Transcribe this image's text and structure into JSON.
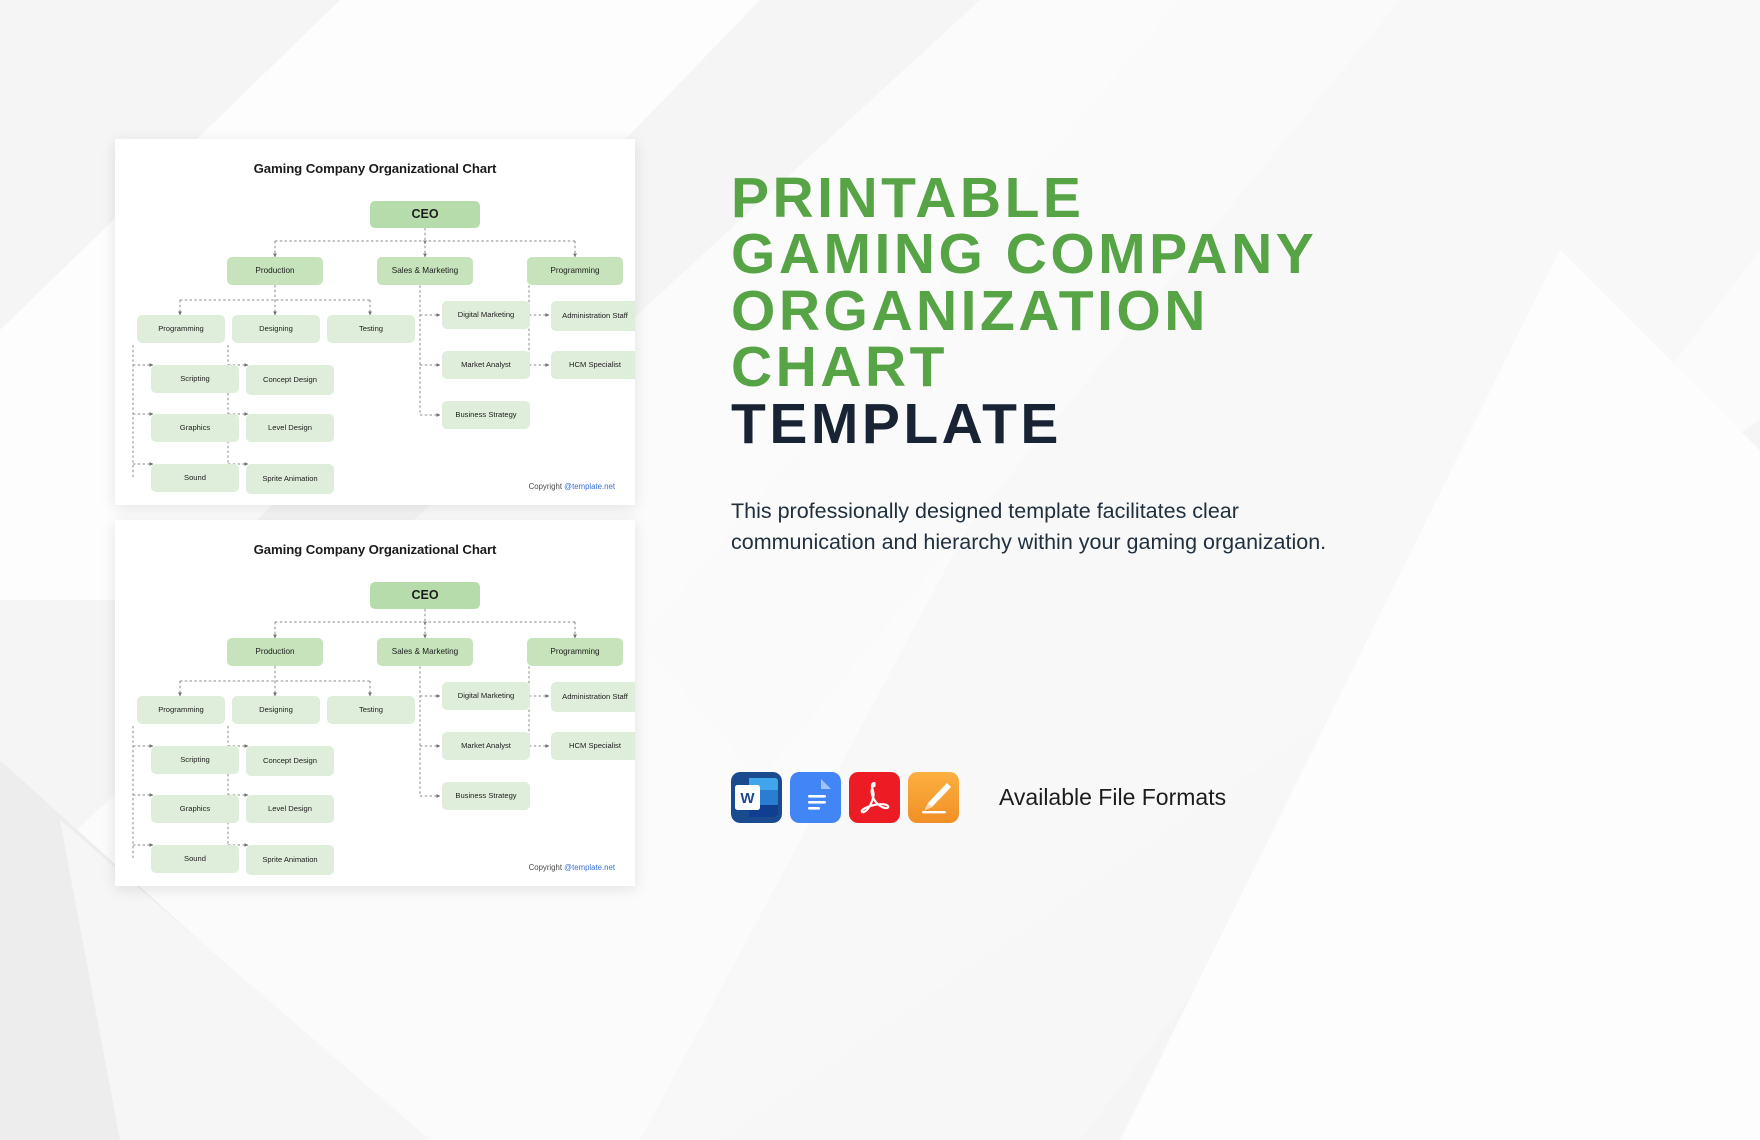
{
  "cards": [
    {
      "id": "card-top",
      "title": "Gaming Company Organizational Chart",
      "copyright_prefix": "Copyright ",
      "copyright_link": "@template.net"
    },
    {
      "id": "card-bottom",
      "title": "Gaming Company Organizational Chart",
      "copyright_prefix": "Copyright ",
      "copyright_link": "@template.net"
    }
  ],
  "chart_data": {
    "type": "diagram",
    "title": "Gaming Company Organizational Chart",
    "root": "CEO",
    "nodes": [
      {
        "label": "CEO",
        "level": 1
      },
      {
        "label": "Production",
        "level": 2
      },
      {
        "label": "Sales & Marketing",
        "level": 2
      },
      {
        "label": "Programming",
        "level": 2
      },
      {
        "label": "Programming",
        "level": 3
      },
      {
        "label": "Designing",
        "level": 3
      },
      {
        "label": "Testing",
        "level": 3
      },
      {
        "label": "Digital Marketing",
        "level": 3
      },
      {
        "label": "Administration Staff",
        "level": 3
      },
      {
        "label": "Scripting",
        "level": 4
      },
      {
        "label": "Concept Design",
        "level": 4
      },
      {
        "label": "Market Analyst",
        "level": 3
      },
      {
        "label": "HCM Specialist",
        "level": 3
      },
      {
        "label": "Graphics",
        "level": 4
      },
      {
        "label": "Level Design",
        "level": 4
      },
      {
        "label": "Business Strategy",
        "level": 3
      },
      {
        "label": "Sound",
        "level": 4
      },
      {
        "label": "Sprite Animation",
        "level": 4
      }
    ],
    "edges": [
      [
        "CEO",
        "Production"
      ],
      [
        "CEO",
        "Sales & Marketing"
      ],
      [
        "CEO",
        "Programming"
      ],
      [
        "Production",
        "Programming"
      ],
      [
        "Production",
        "Designing"
      ],
      [
        "Production",
        "Testing"
      ],
      [
        "Programming",
        "Scripting"
      ],
      [
        "Programming",
        "Graphics"
      ],
      [
        "Programming",
        "Sound"
      ],
      [
        "Designing",
        "Concept Design"
      ],
      [
        "Designing",
        "Level Design"
      ],
      [
        "Designing",
        "Sprite Animation"
      ],
      [
        "Sales & Marketing",
        "Digital Marketing"
      ],
      [
        "Sales & Marketing",
        "Market Analyst"
      ],
      [
        "Sales & Marketing",
        "Business Strategy"
      ],
      [
        "Programming",
        "Administration Staff"
      ],
      [
        "Programming",
        "HCM Specialist"
      ]
    ],
    "colors": {
      "root_fill": "#b7dcab",
      "branch_fill": "#c6e3bb",
      "leaf_fill": "#dfeeda",
      "connector": "#8a8a8a"
    },
    "legend": []
  },
  "chart_nodes": {
    "ceo": "CEO",
    "production": "Production",
    "sales_marketing": "Sales & Marketing",
    "programming_dept": "Programming",
    "programming_sub": "Programming",
    "designing": "Designing",
    "testing": "Testing",
    "scripting": "Scripting",
    "graphics": "Graphics",
    "sound": "Sound",
    "concept_design": "Concept Design",
    "level_design": "Level Design",
    "sprite_animation": "Sprite Animation",
    "digital_marketing": "Digital Marketing",
    "market_analyst": "Market Analyst",
    "business_strategy": "Business Strategy",
    "administration_staff": "Administration Staff",
    "hcm_specialist": "HCM Specialist"
  },
  "promo": {
    "headline_lines": [
      "PRINTABLE",
      "GAMING  COMPANY",
      "ORGANIZATION",
      "CHART"
    ],
    "headline_accent_line": "TEMPLATE",
    "description": "This professionally designed template facilitates clear communication and hierarchy within your gaming organization.",
    "accent_color": "#56a446",
    "dark_color": "#182433"
  },
  "formats": {
    "label": "Available File Formats",
    "items": [
      {
        "name": "word-icon",
        "title": "Word",
        "color": "#2b579a"
      },
      {
        "name": "google-docs-icon",
        "title": "Google Docs",
        "color": "#4285f4"
      },
      {
        "name": "pdf-icon",
        "title": "PDF",
        "color": "#f40f02"
      },
      {
        "name": "apple-pages-icon",
        "title": "Apple Pages",
        "color": "#f5a623"
      }
    ]
  }
}
